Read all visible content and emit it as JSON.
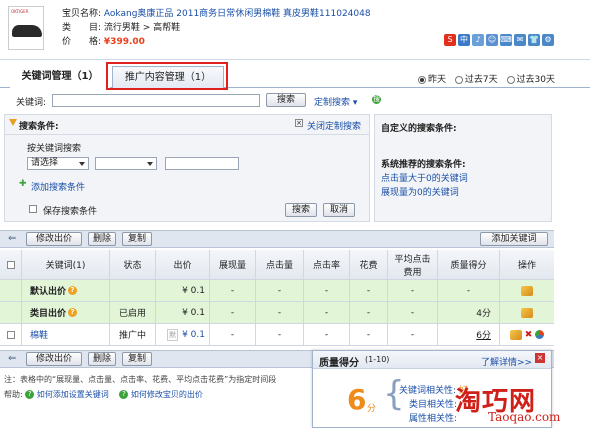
{
  "product": {
    "name_label": "宝贝名称:",
    "name_brand": "Aokang",
    "name_rest": "奥康正品 2011商务日常休闲男棉鞋 真皮男鞋111024048",
    "category_label": "类　　目:",
    "category_value": "流行男鞋 > 高帮鞋",
    "price_label": "价　　格:",
    "price_value": "¥399.00",
    "thumb_brand": "OKTIGER"
  },
  "toolbar": {
    "items": [
      "S",
      "中",
      "♪",
      "☺",
      "⌨",
      "✉",
      "👕",
      "⚙"
    ]
  },
  "tabs": {
    "tab1": "关键词管理（1）",
    "tab2": "推广内容管理（1）"
  },
  "period": {
    "opt1": "昨天",
    "opt2": "过去7天",
    "opt3": "过去30天"
  },
  "search": {
    "label": "关键词:",
    "button": "搜索",
    "custom_search": "定制搜索 ▾",
    "icon": "搜"
  },
  "conditions": {
    "title": "搜索条件:",
    "close_link": "关闭定制搜索",
    "by_keyword": "按关键词搜索",
    "select1": "请选择",
    "select2": "",
    "add_condition": "添加搜索条件",
    "save_condition": "保存搜索条件",
    "search_btn": "搜索",
    "cancel_btn": "取消"
  },
  "custom": {
    "title": "自定义的搜索条件:",
    "system_title": "系统推荐的搜索条件:",
    "link1": "点击量大于0的关键词",
    "link2": "展现量为0的关键词"
  },
  "actions": {
    "modify_bid": "修改出价",
    "delete": "删除",
    "copy": "复制",
    "add_keyword": "添加关键词"
  },
  "table": {
    "headers": [
      "关键词(1)",
      "状态",
      "出价",
      "展现量",
      "点击量",
      "点击率",
      "花费",
      "平均点击费用",
      "质量得分",
      "操作"
    ],
    "rows": [
      {
        "keyword": "默认出价",
        "status": "",
        "bid": "¥ 0.1",
        "impr": "-",
        "clicks": "-",
        "ctr": "-",
        "cost": "-",
        "avg": "-",
        "quality": "-"
      },
      {
        "keyword": "类目出价",
        "status": "已启用",
        "bid": "¥ 0.1",
        "impr": "-",
        "clicks": "-",
        "ctr": "-",
        "cost": "-",
        "avg": "-",
        "quality": "4分"
      },
      {
        "keyword": "棉鞋",
        "status": "推广中",
        "bid": "¥ 0.1",
        "bid_tag": "默",
        "impr": "-",
        "clicks": "-",
        "ctr": "-",
        "cost": "-",
        "avg": "-",
        "quality": "6分"
      }
    ]
  },
  "note": "注：表格中的“展现量、点击量、点击率、花费、平均点击花费”为指定时间段",
  "help": {
    "label": "帮助:",
    "link1": "如何添加设置关键词",
    "link2": "如何修改宝贝的出价"
  },
  "quality_popup": {
    "title": "质量得分",
    "range": "(1-10)",
    "detail": "了解详情>>",
    "score": "6",
    "unit": "分",
    "rel1": "关键词相关性:",
    "rel1_val": "好",
    "rel2": "类目相关性:",
    "rel3": "属性相关性:"
  },
  "watermark": {
    "main": "淘巧网",
    "sub": "Taoqao.com"
  }
}
